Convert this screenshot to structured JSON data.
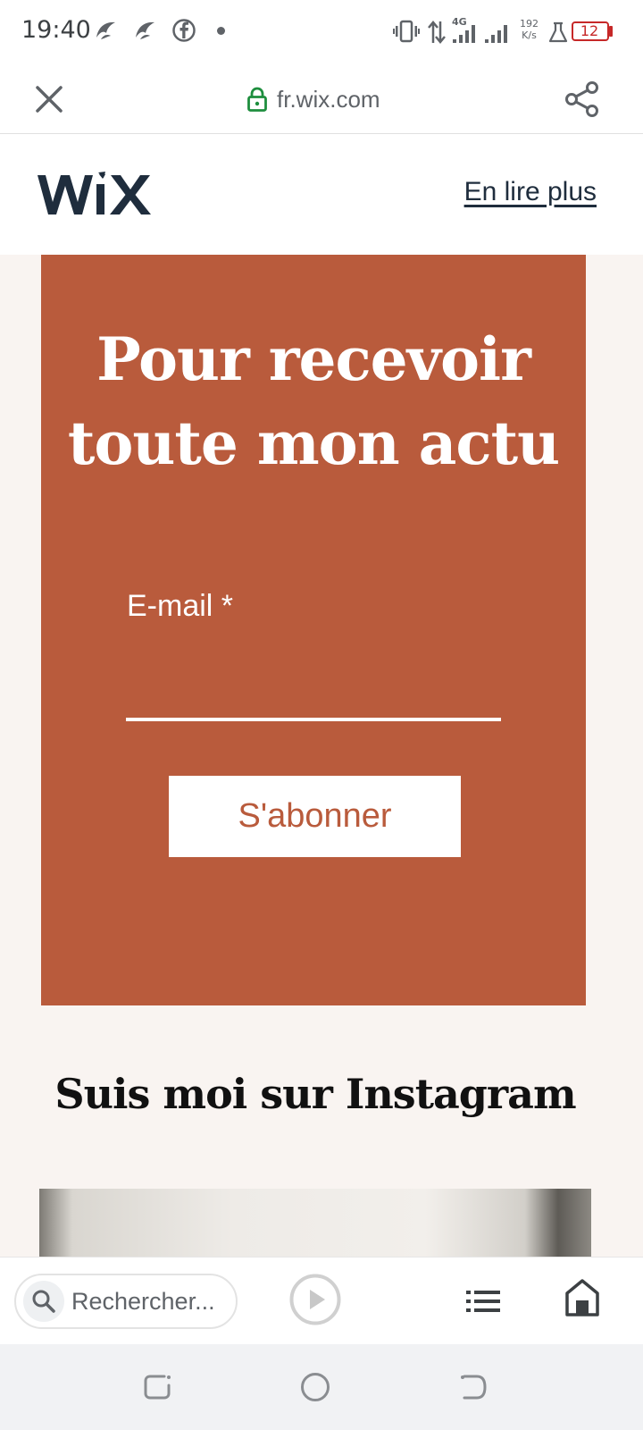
{
  "status_bar": {
    "time": "19:40",
    "network_type": "4G",
    "speed_value": "192",
    "speed_unit": "K/s",
    "battery_level": "12",
    "icons": [
      "app-notification-icon",
      "app-notification-icon",
      "facebook-icon",
      "vibrate-icon",
      "data-transfer-icon",
      "signal-icon",
      "signal-icon",
      "flask-icon",
      "battery-icon"
    ]
  },
  "url_bar": {
    "domain": "fr.wix.com",
    "icons": [
      "close-icon",
      "lock-icon",
      "share-icon"
    ]
  },
  "site_header": {
    "logo_text": "WIX",
    "read_more_label": "En lire plus"
  },
  "newsletter": {
    "heading": "Pour recevoir toute mon actu",
    "email_label": "E-mail *",
    "email_value": "",
    "subscribe_label": "S'abonner",
    "background_color": "#b95b3c"
  },
  "instagram": {
    "heading": "Suis moi sur Instagram"
  },
  "bottom_bar": {
    "search_placeholder": "Rechercher...",
    "icons": [
      "search-icon",
      "play-icon",
      "list-icon",
      "home-icon"
    ]
  },
  "system_nav": {
    "icons": [
      "recents-icon",
      "home-circle-icon",
      "back-icon"
    ]
  },
  "colors": {
    "accent": "#b95b3c",
    "page_background": "#f9f4f1",
    "logo": "#1f2d3d",
    "battery_low": "#c62828"
  }
}
